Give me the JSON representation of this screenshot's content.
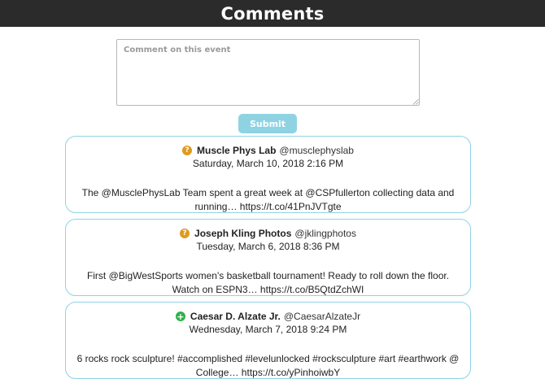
{
  "header": {
    "title": "Comments"
  },
  "comment_form": {
    "placeholder": "Comment on this event",
    "submit_label": "Submit"
  },
  "tweets": [
    {
      "status_icon": "question-circle-icon",
      "status_color": "#e09a1e",
      "name": "Muscle Phys Lab",
      "handle": "@musclephyslab",
      "date": "Saturday, March 10, 2018 2:16 PM",
      "text_line1": "The @MusclePhysLab Team spent a great week at @CSPfullerton collecting data and",
      "text_line2": "running… https://t.co/41PnJVTgte"
    },
    {
      "status_icon": "question-circle-icon",
      "status_color": "#e09a1e",
      "name": "Joseph Kling Photos",
      "handle": "@jklingphotos",
      "date": "Tuesday, March 6, 2018 8:36 PM",
      "text_line1": "First @BigWestSports women's basketball tournament! Ready to roll down the floor.",
      "text_line2": "Watch on ESPN3… https://t.co/B5QtdZchWI"
    },
    {
      "status_icon": "plus-circle-icon",
      "status_color": "#2eb24a",
      "name": "Caesar D. Alzate Jr.",
      "handle": "@CaesarAlzateJr",
      "date": "Wednesday, March 7, 2018 9:24 PM",
      "text_line1": "6 rocks rock sculpture! #accomplished #levelunlocked #rocksculpture #art #earthwork @",
      "text_line2": "College… https://t.co/yPinhoiwbY"
    }
  ]
}
